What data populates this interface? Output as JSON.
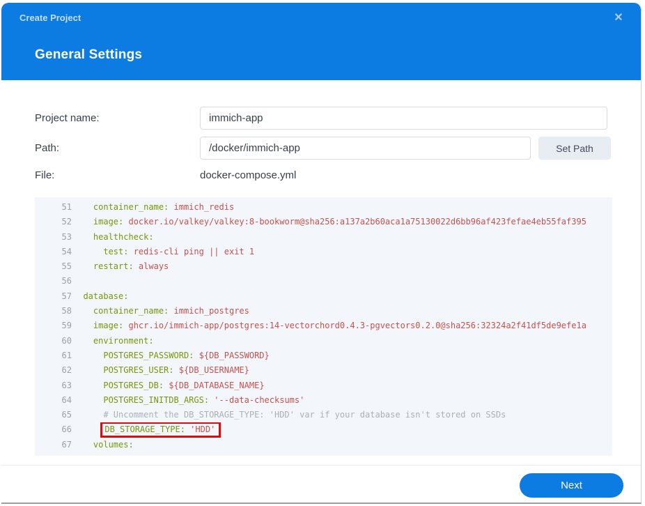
{
  "colors": {
    "accent": "#0d7ce2",
    "key": "#76980a",
    "val": "#c9514e",
    "comment": "#abb1b9",
    "highlight": "#e00b0b"
  },
  "dialog": {
    "title": "Create Project",
    "close_icon": "✕",
    "section_title": "General Settings"
  },
  "form": {
    "project_name": {
      "label": "Project name:",
      "value": "immich-app"
    },
    "path": {
      "label": "Path:",
      "value": "/docker/immich-app",
      "button_label": "Set Path"
    },
    "file": {
      "label": "File:",
      "value": "docker-compose.yml"
    }
  },
  "editor": {
    "lines": [
      {
        "no": "51",
        "segments": [
          {
            "c": "key",
            "t": "    container_name:"
          },
          {
            "c": "val",
            "t": " immich_redis"
          }
        ]
      },
      {
        "no": "52",
        "segments": [
          {
            "c": "key",
            "t": "    image:"
          },
          {
            "c": "val",
            "t": " docker.io/valkey/valkey:8-bookworm@sha256:a137a2b60aca1a75130022d6bb96af423fefae4eb55faf395"
          }
        ]
      },
      {
        "no": "53",
        "segments": [
          {
            "c": "key",
            "t": "    healthcheck:"
          }
        ]
      },
      {
        "no": "54",
        "segments": [
          {
            "c": "key",
            "t": "      test:"
          },
          {
            "c": "val",
            "t": " redis-cli ping || exit 1"
          }
        ]
      },
      {
        "no": "55",
        "segments": [
          {
            "c": "key",
            "t": "    restart:"
          },
          {
            "c": "val",
            "t": " always"
          }
        ]
      },
      {
        "no": "56",
        "segments": []
      },
      {
        "no": "57",
        "segments": [
          {
            "c": "key",
            "t": "  database:"
          }
        ]
      },
      {
        "no": "58",
        "segments": [
          {
            "c": "key",
            "t": "    container_name:"
          },
          {
            "c": "val",
            "t": " immich_postgres"
          }
        ]
      },
      {
        "no": "59",
        "segments": [
          {
            "c": "key",
            "t": "    image:"
          },
          {
            "c": "val",
            "t": " ghcr.io/immich-app/postgres:14-vectorchord0.4.3-pgvectors0.2.0@sha256:32324a2f41df5de9efe1a"
          }
        ]
      },
      {
        "no": "60",
        "segments": [
          {
            "c": "key",
            "t": "    environment:"
          }
        ]
      },
      {
        "no": "61",
        "segments": [
          {
            "c": "key",
            "t": "      POSTGRES_PASSWORD:"
          },
          {
            "c": "val",
            "t": " ${DB_PASSWORD}"
          }
        ]
      },
      {
        "no": "62",
        "segments": [
          {
            "c": "key",
            "t": "      POSTGRES_USER:"
          },
          {
            "c": "val",
            "t": " ${DB_USERNAME}"
          }
        ]
      },
      {
        "no": "63",
        "segments": [
          {
            "c": "key",
            "t": "      POSTGRES_DB:"
          },
          {
            "c": "val",
            "t": " ${DB_DATABASE_NAME}"
          }
        ]
      },
      {
        "no": "64",
        "segments": [
          {
            "c": "key",
            "t": "      POSTGRES_INITDB_ARGS:"
          },
          {
            "c": "val",
            "t": " '--data-checksums'"
          }
        ]
      },
      {
        "no": "65",
        "segments": [
          {
            "c": "comment",
            "t": "      # Uncomment the DB_STORAGE_TYPE: 'HDD' var if your database isn't stored on SSDs"
          }
        ]
      },
      {
        "no": "66",
        "segments": [
          {
            "c": "plain",
            "t": "      "
          }
        ],
        "boxed_segments": [
          {
            "c": "key",
            "t": "DB_STORAGE_TYPE:"
          },
          {
            "c": "val",
            "t": " 'HDD'"
          }
        ]
      },
      {
        "no": "67",
        "segments": [
          {
            "c": "key",
            "t": "    volumes:"
          }
        ]
      }
    ]
  },
  "footer": {
    "next_label": "Next"
  }
}
